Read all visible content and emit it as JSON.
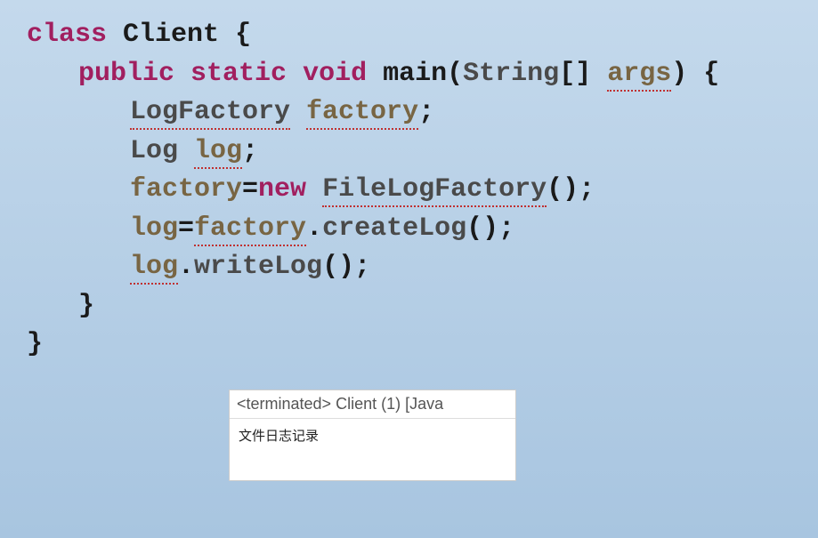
{
  "code": {
    "line1": {
      "kw_class": "class",
      "name": "Client",
      "brace": " {"
    },
    "line2": {
      "kw_public": "public",
      "kw_static": "static",
      "kw_void": "void",
      "method": "main",
      "paren_open": "(",
      "type_string": "String",
      "brackets": "[] ",
      "param": "args",
      "paren_close_brace": ") {"
    },
    "line3": {
      "type": "LogFactory",
      "sp": " ",
      "var": "factory",
      "semi": ";"
    },
    "line4": {
      "type": "Log ",
      "var": "log",
      "semi": ";"
    },
    "line5": {
      "var": "factory",
      "eq": "=",
      "kw_new": "new",
      "sp": " ",
      "ctor": "FileLogFactory",
      "parens": "()",
      "semi": ";"
    },
    "line6": {
      "var": "log",
      "eq": "=",
      "obj": "factory",
      "dot": ".",
      "method": "createLog",
      "parens": "()",
      "semi": ";"
    },
    "line7": {
      "obj": "log",
      "dot": ".",
      "method": "writeLog",
      "parens": "()",
      "semi": ";"
    },
    "line8": {
      "brace": "}"
    },
    "line9": {
      "brace": "}"
    }
  },
  "console": {
    "header": "<terminated> Client (1) [Java",
    "output": "文件日志记录"
  }
}
